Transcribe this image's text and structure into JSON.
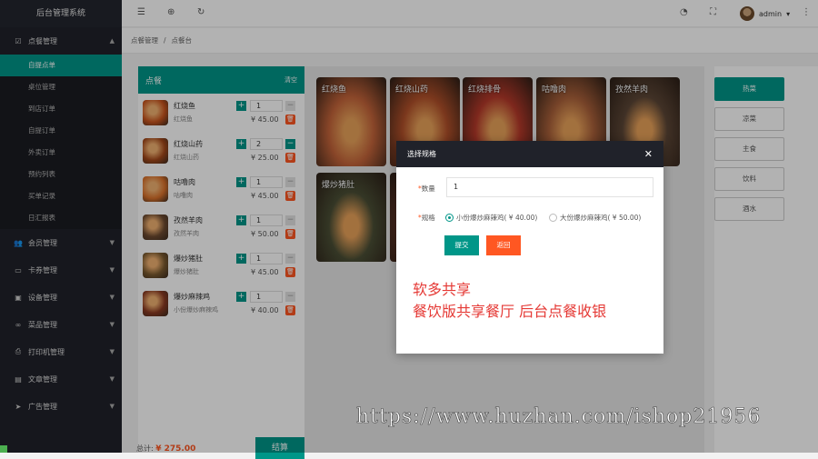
{
  "app": {
    "title": "后台管理系统"
  },
  "sidebar": {
    "groups": [
      {
        "label": "点餐管理",
        "icon": "checkbox-icon",
        "open": true,
        "items": [
          {
            "label": "自提点单",
            "active": true
          },
          {
            "label": "桌位管理"
          },
          {
            "label": "到店订单"
          },
          {
            "label": "自提订单"
          },
          {
            "label": "外卖订单"
          },
          {
            "label": "预约列表"
          },
          {
            "label": "买单记录"
          },
          {
            "label": "日汇报表"
          }
        ]
      },
      {
        "label": "会员管理",
        "icon": "users-icon"
      },
      {
        "label": "卡券管理",
        "icon": "card-icon"
      },
      {
        "label": "设备管理",
        "icon": "device-icon"
      },
      {
        "label": "菜品管理",
        "icon": "bike-icon"
      },
      {
        "label": "打印机管理",
        "icon": "printer-icon"
      },
      {
        "label": "文章管理",
        "icon": "article-icon"
      },
      {
        "label": "广告管理",
        "icon": "send-icon"
      }
    ]
  },
  "topbar": {
    "user": "admin"
  },
  "breadcrumb": [
    "点餐管理",
    "点餐台"
  ],
  "cart": {
    "title": "点餐",
    "clear": "清空",
    "currency": "¥",
    "items": [
      {
        "name": "红烧鱼",
        "sub": "红烧鱼",
        "qty": "1",
        "price": "¥ 45.00",
        "color": "#c8541e"
      },
      {
        "name": "红烧山药",
        "sub": "红烧山药",
        "qty": "2",
        "price": "¥ 25.00",
        "color": "#a3481b"
      },
      {
        "name": "咕噜肉",
        "sub": "咕噜肉",
        "qty": "1",
        "price": "¥ 45.00",
        "color": "#d9712b"
      },
      {
        "name": "孜然羊肉",
        "sub": "孜然羊肉",
        "qty": "1",
        "price": "¥ 50.00",
        "color": "#6d4a30"
      },
      {
        "name": "爆炒猪肚",
        "sub": "爆炒猪肚",
        "qty": "1",
        "price": "¥ 45.00",
        "color": "#7a5a2f"
      },
      {
        "name": "爆炒麻辣鸡",
        "sub": "小份爆炒麻辣鸡",
        "qty": "1",
        "price": "¥ 40.00",
        "color": "#8a3a22"
      }
    ],
    "total_label": "总计:",
    "total_value": "¥ 275.00",
    "checkout": "结算"
  },
  "dishes": [
    {
      "name": "红烧鱼",
      "color": "#c4643a"
    },
    {
      "name": "红烧山药",
      "color": "#b1502a"
    },
    {
      "name": "红烧排骨",
      "color": "#b5392a"
    },
    {
      "name": "咕噜肉",
      "color": "#a9603a"
    },
    {
      "name": "孜然羊肉",
      "color": "#5c4636"
    },
    {
      "name": "爆炒猪肚",
      "color": "#4a4e35"
    },
    {
      "name": "",
      "color": "#6b3a2a"
    }
  ],
  "categories": [
    {
      "label": "热菜",
      "active": true
    },
    {
      "label": "凉菜"
    },
    {
      "label": "主食"
    },
    {
      "label": "饮料"
    },
    {
      "label": "酒水"
    }
  ],
  "modal": {
    "title": "选择规格",
    "qty_label": "数量",
    "qty_value": "1",
    "spec_label": "规格",
    "options": [
      {
        "label": "小份爆炒麻辣鸡( ¥ 40.00)",
        "selected": true
      },
      {
        "label": "大份爆炒麻辣鸡( ¥ 50.00)",
        "selected": false
      }
    ],
    "submit": "提交",
    "back": "返回",
    "promo_line1": "软多共享",
    "promo_line2": "餐饮版共享餐厅    后台点餐收银"
  },
  "watermark": "https://www.huzhan.com/ishop21956",
  "colors": {
    "accent": "#009688",
    "danger": "#ff5722",
    "sidebar": "#20222a"
  }
}
